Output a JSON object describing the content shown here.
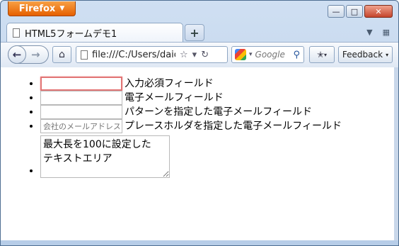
{
  "app": {
    "menu_button": "Firefox"
  },
  "window_controls": {
    "minimize": "—",
    "maximize": "□",
    "close": "✕"
  },
  "tab": {
    "title": "HTML5フォームデモ1",
    "new_tab": "+"
  },
  "toolbar": {
    "url": "file:///C:/Users/daich",
    "search_placeholder": "Google",
    "feedback_label": "Feedback"
  },
  "form": {
    "fields": [
      {
        "label": "入力必須フィールド",
        "value": "",
        "placeholder": ""
      },
      {
        "label": "電子メールフィールド",
        "value": "",
        "placeholder": ""
      },
      {
        "label": "パターンを指定した電子メールフィールド",
        "value": "",
        "placeholder": ""
      },
      {
        "label": "プレースホルダを指定した電子メールフィールド",
        "value": "",
        "placeholder": "会社のメールアドレスを入力"
      }
    ],
    "textarea": {
      "value": "最大長を100に設定した\nテキストエリア"
    }
  }
}
